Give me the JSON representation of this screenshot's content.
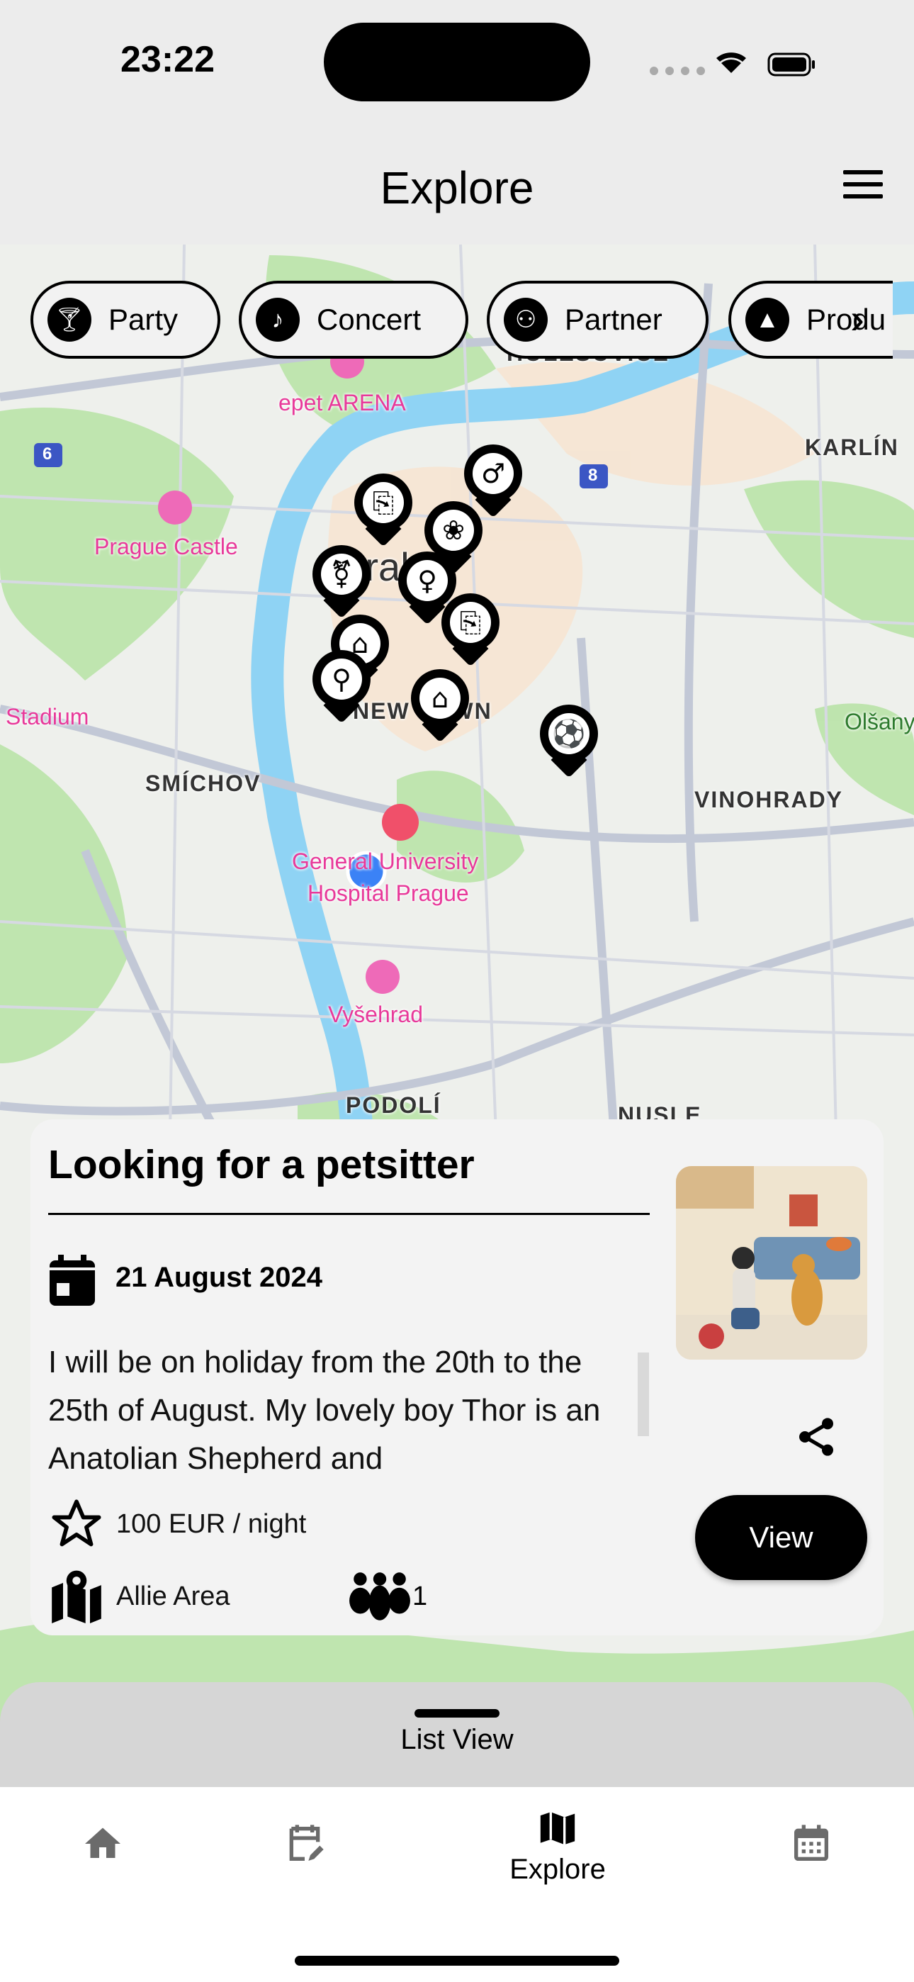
{
  "status_bar": {
    "time": "23:22"
  },
  "header": {
    "title": "Explore",
    "menu_icon": "hamburger-icon"
  },
  "filters": [
    {
      "label": "Party",
      "icon": "cocktail-icon"
    },
    {
      "label": "Concert",
      "icon": "music-note-icon"
    },
    {
      "label": "Partner",
      "icon": "people-icon"
    },
    {
      "label": "Produ",
      "icon": "shapes-icon"
    }
  ],
  "map": {
    "labels": {
      "arena": "epet ARENA",
      "castle": "Prague Castle",
      "stadium": "Stadium",
      "smichov": "SMÍCHOV",
      "karlin": "KARLÍN",
      "vinohrady": "VINOHRADY",
      "hospital1": "General University",
      "hospital2": "Hospital Prague",
      "vysehrad": "Vyšehrad",
      "podoli": "PODOLÍ",
      "newtown": "NEW TOWN",
      "praha": "Praha",
      "olsany": "Olšany",
      "holesovice": "HOLEŠOVICE",
      "nusle": "NUSLE",
      "route6": "6",
      "route8": "8"
    },
    "pins": [
      "clip",
      "male",
      "paw",
      "transgender",
      "female",
      "clip",
      "house",
      "search",
      "house",
      "soccer"
    ]
  },
  "card": {
    "title": "Looking for a petsitter",
    "date": "21 August 2024",
    "description": "I will be on holiday from the 20th to the 25th of August. My lovely boy Thor is an Anatolian Shepherd and",
    "price": "100 EUR / night",
    "area": "Allie Area",
    "members": "1",
    "view_label": "View"
  },
  "sheet": {
    "label": "List View"
  },
  "tabs": [
    {
      "label": "",
      "icon": "home-icon"
    },
    {
      "label": "",
      "icon": "edit-calendar-icon"
    },
    {
      "label": "Explore",
      "icon": "map-icon",
      "active": true
    },
    {
      "label": "",
      "icon": "calendar-icon"
    }
  ]
}
